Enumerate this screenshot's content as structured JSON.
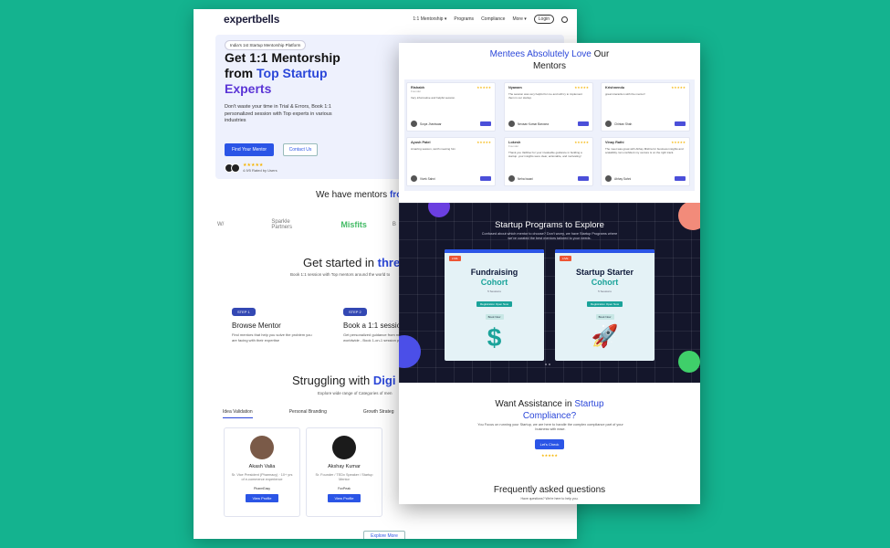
{
  "back_page": {
    "logo": "expertbells",
    "nav": [
      "1:1 Mentorship ▾",
      "Programs",
      "Compliance",
      "More ▾",
      "Login"
    ],
    "hero": {
      "badge": "India's 1st Startup Mentorship Platform",
      "title_1": "Get 1:1 Mentorship",
      "title_2a": "from ",
      "title_2b": "Top Startup",
      "title_3": "Experts",
      "subtitle": "Don't waste your time in Trial & Errors, Book 1:1 personalized session with Top experts in various industries",
      "primary_btn": "Find Your Mentor",
      "secondary_btn": "Contact Us",
      "stars": "★★★★★",
      "rating_text": "4.9/5 Rated by Users"
    },
    "mentors_from_a": "We have mentors ",
    "mentors_from_b": "from",
    "partners": [
      "W/",
      "Sparkle Partners",
      "Misfits",
      "B"
    ],
    "started_a": "Get started in ",
    "started_b": "thre",
    "started_sub": "Book 1:1 session with Top mentors around the world to",
    "steps": [
      {
        "badge": "STEP 1",
        "title": "Browse Mentor",
        "desc": "Find mentors that help you solve the problem you are facing with their expertise"
      },
      {
        "badge": "STEP 2",
        "title": "Book a 1:1 session",
        "desc": "Get personalized guidance from mentors around worldwide - Book 1-on-1 session problems"
      }
    ],
    "struggle_a": "Struggling with ",
    "struggle_b": "Digi",
    "struggle_sub": "Explore wide range of Categories of men",
    "tabs": [
      "Idea Validation",
      "Personal Branding",
      "Growth Strateg"
    ],
    "mentors": [
      {
        "name": "Akash Valia",
        "role": "Sr. Vice President (Pharmacy) · 10+ yrs of e-commerce experience",
        "company": "PharmEasy",
        "button": "View Profile"
      },
      {
        "name": "Akshay Kumar",
        "role": "Sr. Founder / TEDx Speaker / Startup Mentor",
        "company": "FoxPeak",
        "button": "View Profile"
      }
    ],
    "explore_btn": "Explore More"
  },
  "front_page": {
    "love_a": "Mentees Absolutely Love",
    "love_b": " Our",
    "love_c": "Mentors",
    "testimonials": [
      {
        "name": "Rishabh",
        "role": "Founder",
        "text": "Very informative and helpful session.",
        "mentor": "Surya Jhaviwaar",
        "stars": "★★★★★"
      },
      {
        "name": "Nyanam",
        "role": "",
        "text": "The session was very helpful for me and will try to implement them in our startup.",
        "mentor": "Nevaan Kumar Barowra",
        "stars": "★★★★★"
      },
      {
        "name": "Krishnendu",
        "role": "",
        "text": "great interaction with the mentor!",
        "mentor": "Chintan Shah",
        "stars": "★★★★★"
      },
      {
        "name": "Ayush Patel",
        "role": "",
        "text": "Amazing session, worth meeting him",
        "mentor": "Vivek Sahni",
        "stars": "★★★★★"
      },
      {
        "name": "Lokesh",
        "role": "Founder",
        "text": "Thank you Vaibhav for your invaluable guidance in building a startup. your insights were clear, actionable, and motivating!",
        "mentor": "Neha Issani",
        "stars": "★★★★★"
      },
      {
        "name": "Vinay Rathi",
        "role": "",
        "text": "The meet was great with Abhay Mishra for business insights and scalability. Iam confident my venture is on the right track.",
        "mentor": "Abhay Sahni",
        "stars": "★★★★★"
      }
    ],
    "programs_title": "Startup Programs to Explore",
    "programs_sub": "Confused about which mentor to choose? Don't worry, we have Startup Programs where we've curated the best mentors tailored to your needs.",
    "programs": [
      {
        "live": "LIVE",
        "title_1": "Fundraising",
        "title_2": "Cohort",
        "line": "5 Sessions",
        "tag": "Registration Open Now",
        "button": "Book Now",
        "glyph": "$"
      },
      {
        "live": "LIVE",
        "title_1": "Startup Starter",
        "title_2": "Cohort",
        "line": "5 Sessions",
        "tag": "Registration Open Now",
        "button": "Book Now",
        "glyph": "🚀"
      }
    ],
    "assist_a": "Want Assistance in ",
    "assist_b": "Startup",
    "assist_c": "Compliance?",
    "assist_sub": "You Focus on running your Startup, we are here to handle the complex compliance part of your business with ease.",
    "check_btn": "Let's Check",
    "check_stars": "★★★★★",
    "faq_title": "Frequently asked questions",
    "faq_sub": "Have questions? We're here to help you."
  }
}
